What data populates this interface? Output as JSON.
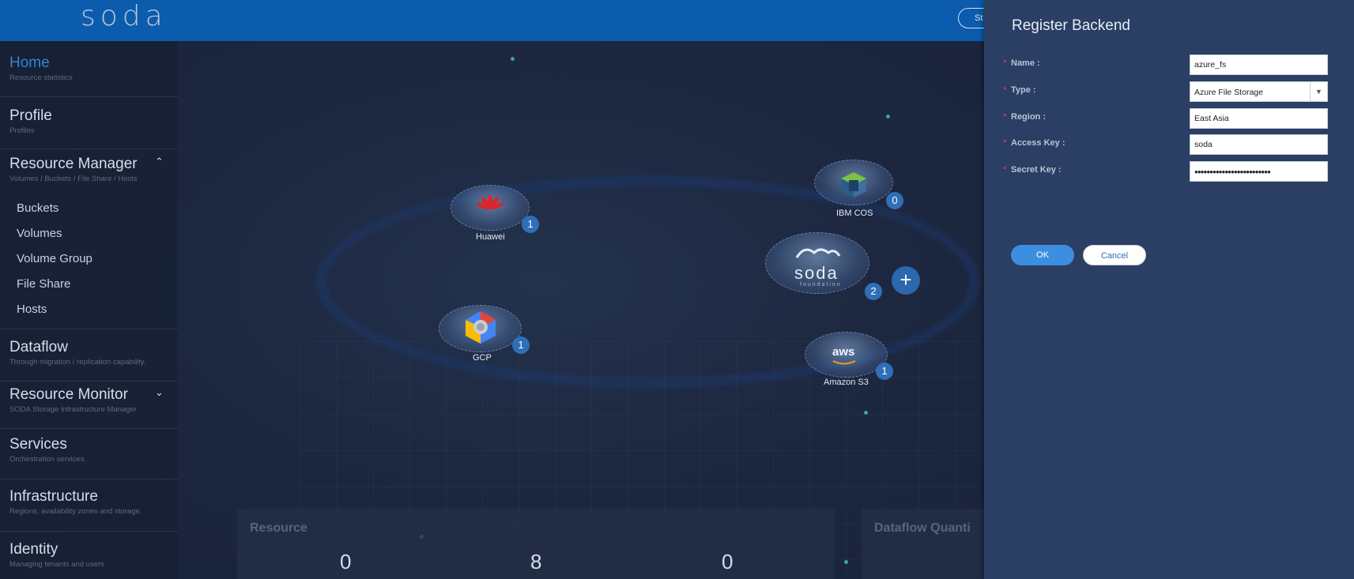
{
  "header": {
    "logo": "soda",
    "pill_label": "St"
  },
  "sidebar": {
    "items": [
      {
        "label": "Home",
        "sub": "Resource statistics"
      },
      {
        "label": "Profile",
        "sub": "Profiles"
      },
      {
        "label": "Resource Manager",
        "sub": "Volumes / Buckets / File Share / Hosts",
        "expanded_icon": "chevron-up-icon"
      },
      {
        "label": "Dataflow",
        "sub": "Through migration / replication capability."
      },
      {
        "label": "Resource Monitor",
        "sub": "SODA Storage Infrastructure Manager",
        "collapsed_icon": "chevron-down-icon"
      },
      {
        "label": "Services",
        "sub": "Orchestration services."
      },
      {
        "label": "Infrastructure",
        "sub": "Regions, availability zones and storage."
      },
      {
        "label": "Identity",
        "sub": "Managing tenants and users"
      }
    ],
    "resource_manager_children": [
      "Buckets",
      "Volumes",
      "Volume Group",
      "File Share",
      "Hosts"
    ],
    "chevron_up": "⌃",
    "chevron_down": "⌄"
  },
  "clouds": [
    {
      "name": "Huawei",
      "count": "1",
      "icon": "huawei-logo-icon"
    },
    {
      "name": "GCP",
      "count": "1",
      "icon": "gcp-logo-icon"
    },
    {
      "name": "IBM COS",
      "count": "0",
      "icon": "ibm-cos-icon"
    },
    {
      "name": "soda",
      "sub": "foundation",
      "count": "2",
      "icon": "soda-foundation-icon"
    },
    {
      "name": "Amazon S3",
      "count": "1",
      "icon": "aws-logo-icon",
      "logo_text": "aws"
    }
  ],
  "add_backend": "+",
  "cards": {
    "resource": {
      "title": "Resource",
      "values": [
        "0",
        "8",
        "0"
      ]
    },
    "dataflow": {
      "title": "Dataflow Quanti"
    }
  },
  "panel": {
    "title": "Register Backend",
    "required_mark": "*",
    "fields": {
      "name": {
        "label": "Name :",
        "value": "azure_fs"
      },
      "type": {
        "label": "Type :",
        "value": "Azure File Storage"
      },
      "region": {
        "label": "Region :",
        "value": "East Asia"
      },
      "access_key": {
        "label": "Access Key :",
        "value": "soda"
      },
      "secret_key": {
        "label": "Secret Key :",
        "value": "●●●●●●●●●●●●●●●●●●●●●●●●●"
      }
    },
    "ok_label": "OK",
    "cancel_label": "Cancel"
  },
  "colors": {
    "header": "#0b5cad",
    "active_nav": "#2f86d8",
    "panel_bg": "#2b3e63",
    "primary_button": "#3b8ee0",
    "required": "#d94b4b",
    "badge": "#2f6fb7"
  }
}
